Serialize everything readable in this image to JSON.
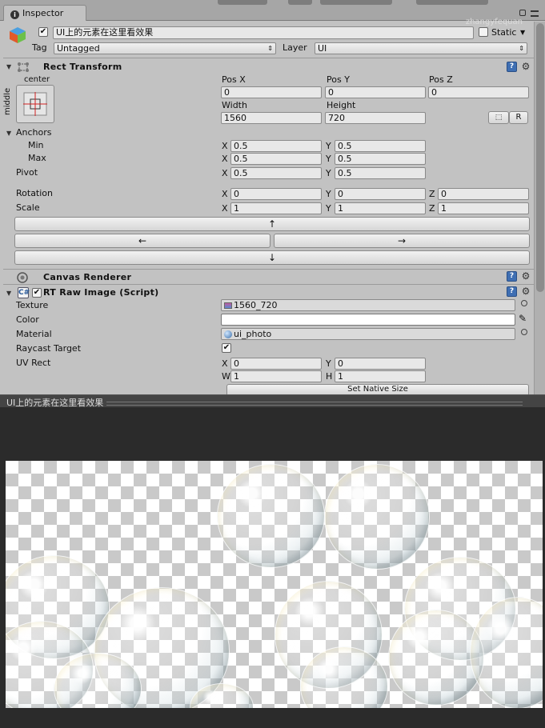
{
  "tab": {
    "label": "Inspector"
  },
  "watermark": "zhangyfequan",
  "gameobject": {
    "active": true,
    "name": "UI上的元素在这里看效果",
    "static_label": "Static",
    "static_checked": false,
    "tag_label": "Tag",
    "tag_value": "Untagged",
    "layer_label": "Layer",
    "layer_value": "UI"
  },
  "rect_transform": {
    "title": "Rect Transform",
    "anchor_top": "center",
    "anchor_side": "middle",
    "pos_x_label": "Pos X",
    "pos_x": "0",
    "pos_y_label": "Pos Y",
    "pos_y": "0",
    "pos_z_label": "Pos Z",
    "pos_z": "0",
    "width_label": "Width",
    "width": "1560",
    "height_label": "Height",
    "height": "720",
    "r_button": "R",
    "anchors_label": "Anchors",
    "min_label": "Min",
    "min_x": "0.5",
    "min_y": "0.5",
    "max_label": "Max",
    "max_x": "0.5",
    "max_y": "0.5",
    "pivot_label": "Pivot",
    "pivot_x": "0.5",
    "pivot_y": "0.5",
    "rotation_label": "Rotation",
    "rot_x": "0",
    "rot_y": "0",
    "rot_z": "0",
    "scale_label": "Scale",
    "scale_x": "1",
    "scale_y": "1",
    "scale_z": "1",
    "x": "X",
    "y": "Y",
    "z": "Z"
  },
  "arrows": {
    "up": "↑",
    "left": "←",
    "right": "→",
    "down": "↓"
  },
  "canvas_renderer": {
    "title": "Canvas Renderer"
  },
  "raw_image": {
    "title": "RT Raw Image (Script)",
    "enabled": true,
    "texture_label": "Texture",
    "texture_value": "1560_720",
    "color_label": "Color",
    "material_label": "Material",
    "material_value": "ui_photo",
    "raycast_label": "Raycast Target",
    "raycast_checked": true,
    "uvrect_label": "UV Rect",
    "uv_x": "0",
    "uv_y": "0",
    "uv_w": "1",
    "uv_h": "1",
    "w": "W",
    "h": "H",
    "native_size_button": "Set Native Size"
  },
  "preview": {
    "title": "UI上的元素在这里看效果"
  },
  "colors": {
    "panel": "#c2c2c2",
    "preview_bg": "#2b2b2b",
    "help_blue": "#3f6fb3"
  }
}
